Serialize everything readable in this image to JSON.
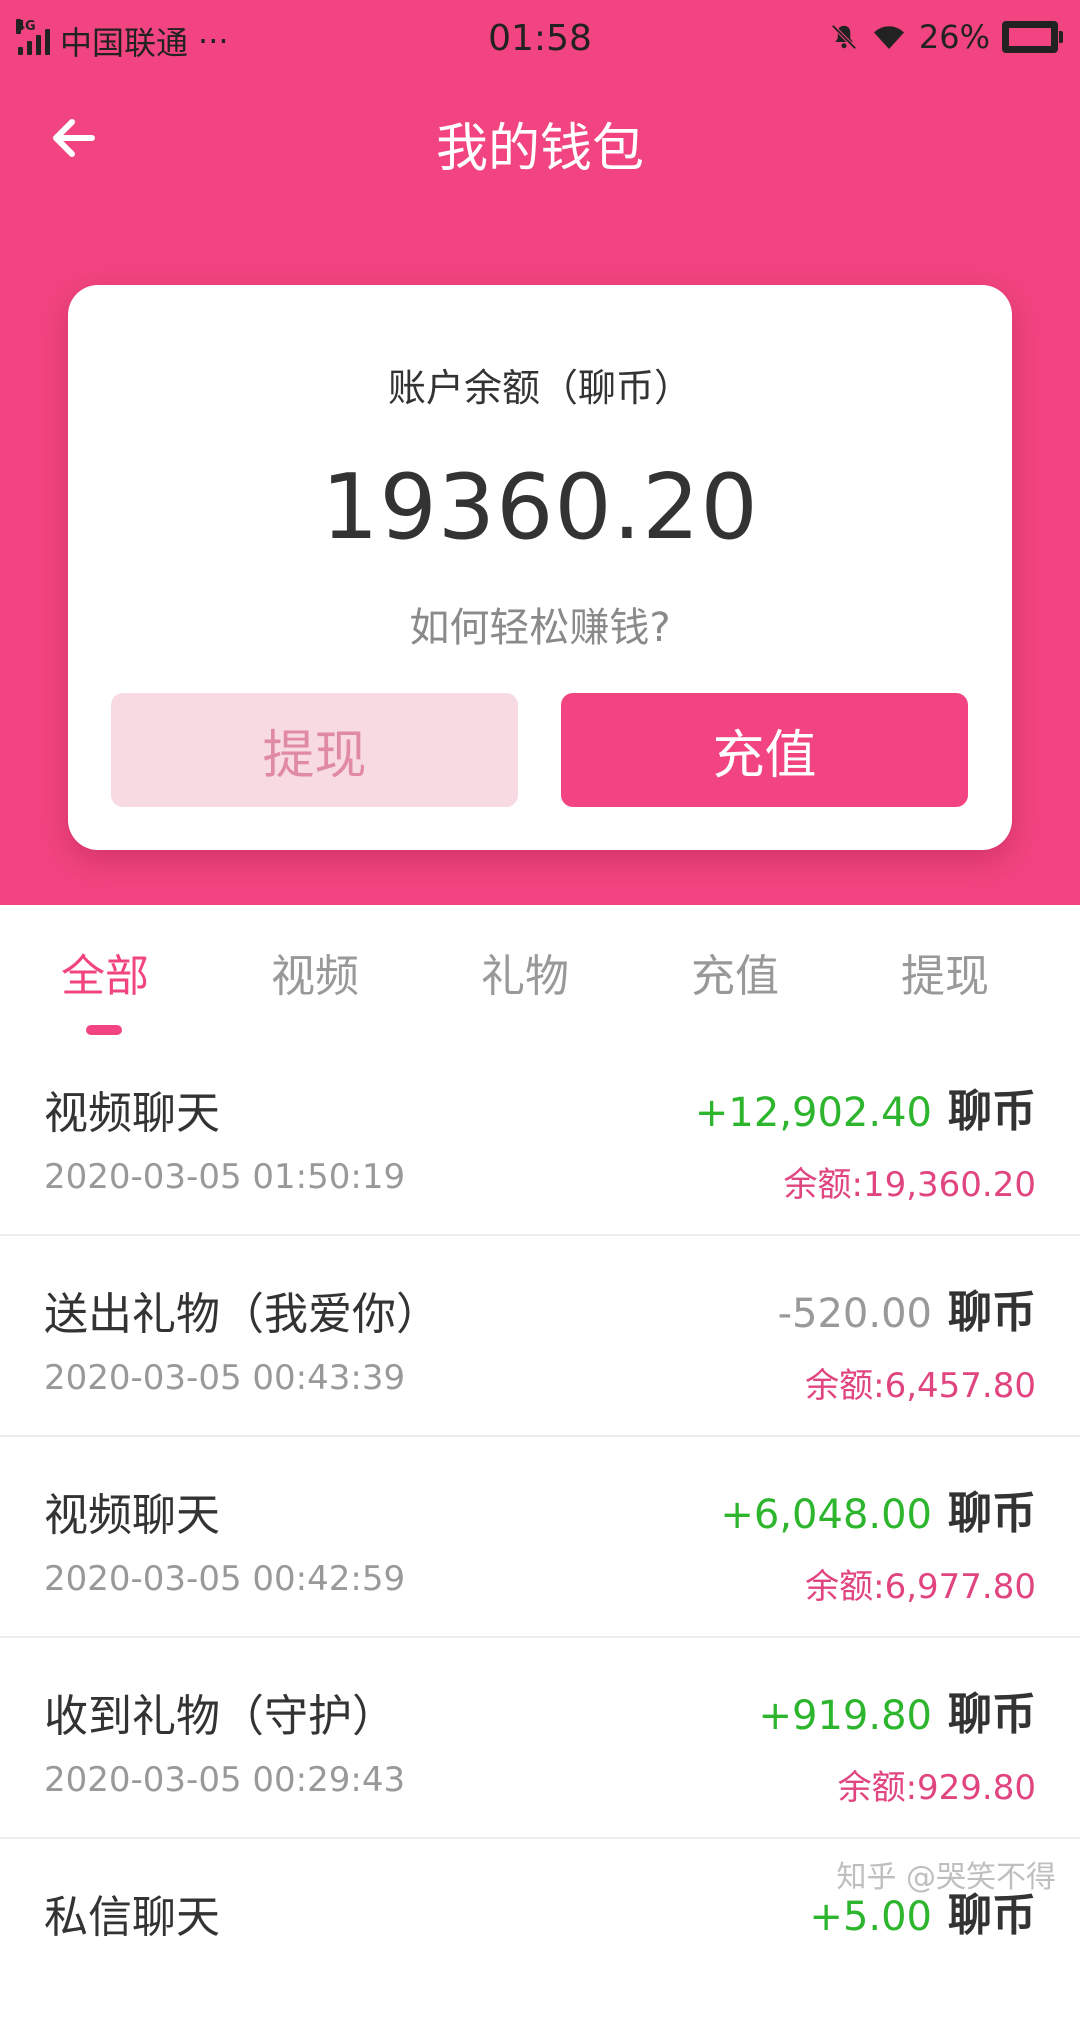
{
  "status_bar": {
    "network_type": "4G",
    "carrier": "中国联通",
    "more": "···",
    "time": "01:58",
    "battery": "26%",
    "icons": [
      "signal-icon",
      "mute-bell-icon",
      "wifi-icon",
      "battery-charging-icon"
    ]
  },
  "nav": {
    "title": "我的钱包",
    "back_icon": "arrow-left-icon"
  },
  "card": {
    "balance_label": "账户余额（聊币）",
    "balance_value": "19360.20",
    "earn_link": "如何轻松赚钱?",
    "withdraw_label": "提现",
    "recharge_label": "充值"
  },
  "tabs": [
    {
      "label": "全部",
      "active": true
    },
    {
      "label": "视频",
      "active": false
    },
    {
      "label": "礼物",
      "active": false
    },
    {
      "label": "充值",
      "active": false
    },
    {
      "label": "提现",
      "active": false
    }
  ],
  "transactions": [
    {
      "title": "视频聊天",
      "amount": "+12,902.40",
      "unit": "聊币",
      "time": "2020-03-05 01:50:19",
      "balance": "余额:19,360.20",
      "type": "pos"
    },
    {
      "title": "送出礼物（我爱你）",
      "amount": "-520.00",
      "unit": "聊币",
      "time": "2020-03-05 00:43:39",
      "balance": "余额:6,457.80",
      "type": "neg"
    },
    {
      "title": "视频聊天",
      "amount": "+6,048.00",
      "unit": "聊币",
      "time": "2020-03-05 00:42:59",
      "balance": "余额:6,977.80",
      "type": "pos"
    },
    {
      "title": "收到礼物（守护）",
      "amount": "+919.80",
      "unit": "聊币",
      "time": "2020-03-05 00:29:43",
      "balance": "余额:929.80",
      "type": "pos"
    },
    {
      "title": "私信聊天",
      "amount": "+5.00",
      "unit": "聊币",
      "time": "",
      "balance": "",
      "type": "pos"
    }
  ],
  "watermark": "知乎 @哭笑不得",
  "colors": {
    "accent": "#f24480",
    "positive": "#2db52d",
    "balance": "#e0457f"
  }
}
